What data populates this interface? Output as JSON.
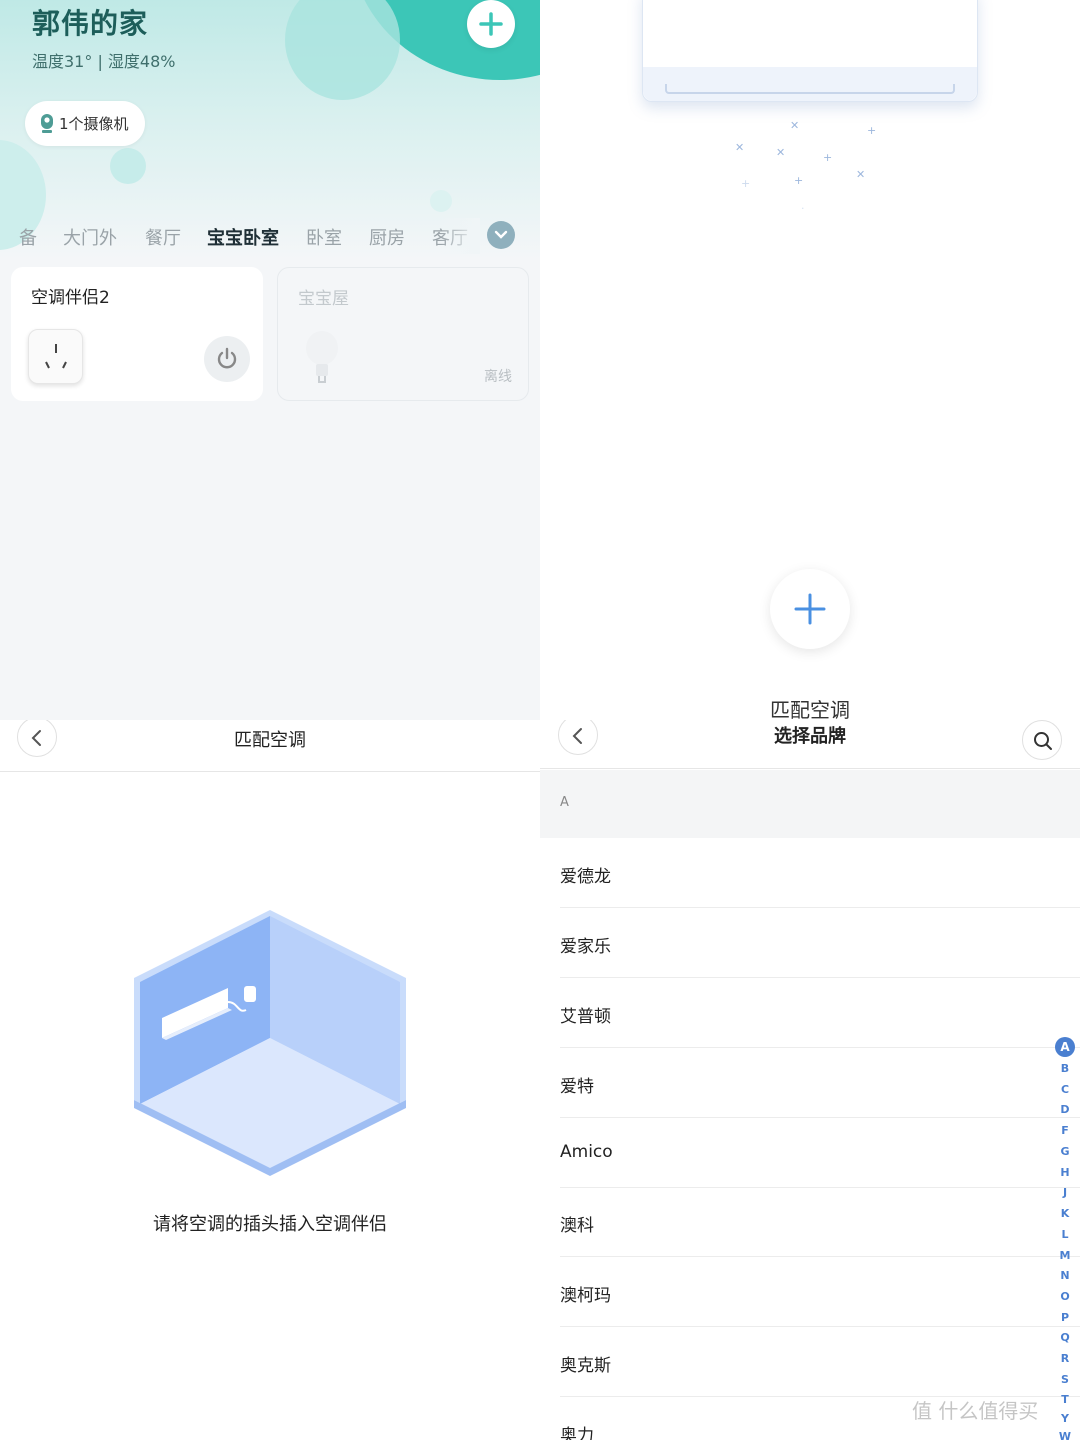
{
  "home": {
    "title": "郭伟的家",
    "subtitle": "温度31° | 湿度48%",
    "camera_label": "1个摄像机",
    "tabs": [
      "备",
      "大门外",
      "餐厅",
      "宝宝卧室",
      "卧室",
      "厨房",
      "客厅"
    ],
    "active_tab": "宝宝卧室",
    "devices": [
      {
        "name": "空调伴侣2",
        "status": "online"
      },
      {
        "name": "宝宝屋",
        "status": "离线"
      }
    ],
    "accent_color": "#3cc6b7"
  },
  "illustration": {
    "title": "匹配空调"
  },
  "match": {
    "title": "匹配空调",
    "hint": "请将空调的插头插入空调伴侣"
  },
  "brands": {
    "title": "选择品牌",
    "section": "A",
    "items": [
      "爱德龙",
      "爱家乐",
      "艾普顿",
      "爱特",
      "Amico",
      "澳科",
      "澳柯玛",
      "奥克斯",
      "奥力"
    ],
    "index": [
      "A",
      "B",
      "C",
      "D",
      "F",
      "G",
      "H",
      "J",
      "K",
      "L",
      "M",
      "N",
      "O",
      "P",
      "Q",
      "R",
      "S",
      "T",
      "Y",
      "W"
    ],
    "accent_color": "#4a7fd0"
  },
  "watermark": "值 什么值得买"
}
